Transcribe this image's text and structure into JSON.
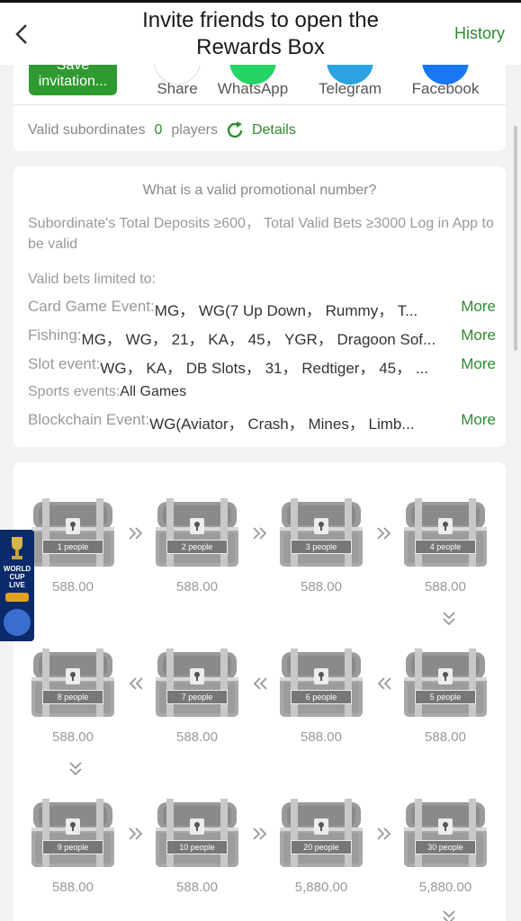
{
  "header": {
    "title": "Invite friends to open the Rewards Box",
    "history_label": "History"
  },
  "share": {
    "save_label": "Save invitation...",
    "items": [
      {
        "label": "Share",
        "icon": "share-icon",
        "color": "#ffffff"
      },
      {
        "label": "WhatsApp",
        "icon": "whatsapp-icon",
        "color": "#25d366"
      },
      {
        "label": "Telegram",
        "icon": "telegram-icon",
        "color": "#2aa3e0"
      },
      {
        "label": "Facebook",
        "icon": "facebook-icon",
        "color": "#1877f2"
      }
    ]
  },
  "subordinates": {
    "label": "Valid subordinates",
    "count": "0",
    "unit": "players",
    "details_label": "Details"
  },
  "promo": {
    "question": "What is a valid promotional number?",
    "description": "Subordinate's Total Deposits ≥600， Total Valid Bets ≥3000 Log in App to be valid",
    "limited_label": "Valid bets limited to:",
    "more_label": "More",
    "rows": [
      {
        "category": "Card Game Event: ",
        "value": "MG， WG(7 Up Down， Rummy， T...",
        "more": "More"
      },
      {
        "category": "Fishing: ",
        "value": "MG， WG， 21， KA， 45， YGR， Dragoon Sof...",
        "more": "More"
      },
      {
        "category": "Slot event: ",
        "value": "WG， KA， DB Slots， 31， Redtiger， 45， ...",
        "more": "More"
      },
      {
        "category": "Sports events: ",
        "value": "All Games",
        "more": ""
      },
      {
        "category": "Blockchain Event: ",
        "value": "WG(Aviator， Crash， Mines， Limb...",
        "more": "More"
      }
    ]
  },
  "boxes": [
    {
      "people": "1 people",
      "amount": "588.00"
    },
    {
      "people": "2 people",
      "amount": "588.00"
    },
    {
      "people": "3 people",
      "amount": "588.00"
    },
    {
      "people": "4 people",
      "amount": "588.00"
    },
    {
      "people": "8 people",
      "amount": "588.00"
    },
    {
      "people": "7 people",
      "amount": "588.00"
    },
    {
      "people": "6 people",
      "amount": "588.00"
    },
    {
      "people": "5 people",
      "amount": "588.00"
    },
    {
      "people": "9 people",
      "amount": "588.00"
    },
    {
      "people": "10 people",
      "amount": "588.00"
    },
    {
      "people": "20 people",
      "amount": "5,880.00"
    },
    {
      "people": "30 people",
      "amount": "5,880.00"
    }
  ],
  "side_banner": {
    "text_line1": "WORLD",
    "text_line2": "CUP",
    "text_line3": "LIVE"
  },
  "colors": {
    "accent": "#2e8b2e",
    "button": "#2f9a2f"
  }
}
